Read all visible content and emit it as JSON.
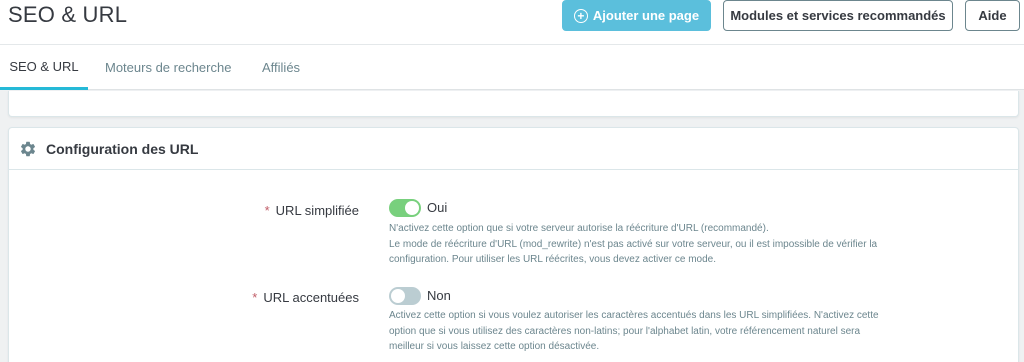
{
  "header": {
    "title": "SEO & URL",
    "add_page_label": "Ajouter une page",
    "modules_label": "Modules et services recommandés",
    "help_label": "Aide"
  },
  "tabs": [
    {
      "label": "SEO & URL",
      "active": true
    },
    {
      "label": "Moteurs de recherche",
      "active": false
    },
    {
      "label": "Affiliés",
      "active": false
    }
  ],
  "panel": {
    "title": "Configuration des URL",
    "icon": "gear-icon",
    "fields": [
      {
        "required_mark": "*",
        "label": "URL simplifiée",
        "enabled": true,
        "switch_label": "Oui",
        "help": [
          "N'activez cette option que si votre serveur autorise la réécriture d'URL (recommandé).",
          "Le mode de réécriture d'URL (mod_rewrite) n'est pas activé sur votre serveur, ou il est impossible de vérifier la",
          "configuration. Pour utiliser les URL réécrites, vous devez activer ce mode."
        ]
      },
      {
        "required_mark": "*",
        "label": "URL accentuées",
        "enabled": false,
        "switch_label": "Non",
        "help": [
          "Activez cette option si vous voulez autoriser les caractères accentués dans les URL simplifiées. N'activez cette",
          "option que si vous utilisez des caractères non-latins; pour l'alphabet latin, votre référencement naturel sera",
          "meilleur si vous laissez cette option désactivée."
        ]
      }
    ]
  },
  "colors": {
    "primary": "#5bbfdc",
    "tab_active": "#25b9d7",
    "switch_on": "#78d07d",
    "switch_off": "#bbcdd2",
    "required": "#c05c67"
  }
}
